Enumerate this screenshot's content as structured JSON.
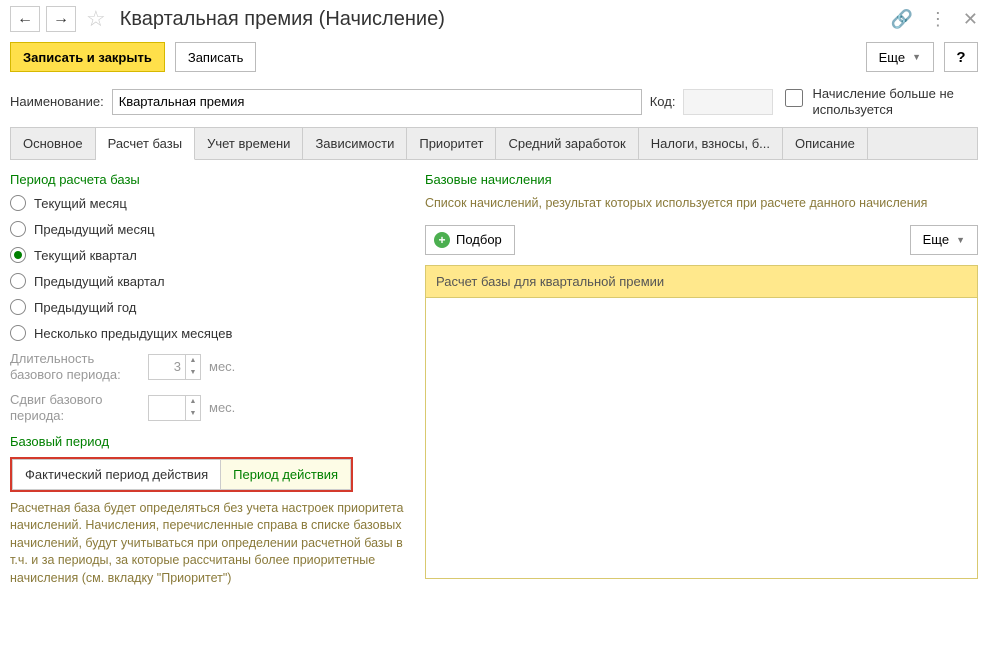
{
  "header": {
    "title": "Квартальная премия (Начисление)"
  },
  "actions": {
    "save_close": "Записать и закрыть",
    "save": "Записать",
    "more": "Еще",
    "help": "?"
  },
  "form": {
    "name_label": "Наименование:",
    "name_value": "Квартальная премия",
    "code_label": "Код:",
    "code_value": "",
    "disabled_label": "Начисление больше не используется"
  },
  "tabs": [
    "Основное",
    "Расчет базы",
    "Учет времени",
    "Зависимости",
    "Приоритет",
    "Средний заработок",
    "Налоги, взносы, б...",
    "Описание"
  ],
  "active_tab": 1,
  "left": {
    "group1_title": "Период расчета базы",
    "radios": [
      "Текущий месяц",
      "Предыдущий месяц",
      "Текущий квартал",
      "Предыдущий квартал",
      "Предыдущий год",
      "Несколько предыдущих месяцев"
    ],
    "selected_radio": 2,
    "duration_label": "Длительность базового периода:",
    "duration_value": "3",
    "duration_unit": "мес.",
    "shift_label": "Сдвиг базового периода:",
    "shift_value": "",
    "shift_unit": "мес.",
    "group2_title": "Базовый период",
    "bp_btn1": "Фактический период действия",
    "bp_btn2": "Период действия",
    "note": "Расчетная база будет определяться без учета настроек приоритета начислений. Начисления, перечисленные справа в списке базовых начислений, будут учитываться при определении расчетной базы в т.ч. и за периоды, за которые рассчитаны более приоритетные начисления (см. вкладку \"Приоритет\")"
  },
  "right": {
    "group_title": "Базовые начисления",
    "desc": "Список начислений, результат которых используется при расчете данного начисления",
    "select_btn": "Подбор",
    "more": "Еще",
    "table_header": "Расчет базы для квартальной премии"
  }
}
